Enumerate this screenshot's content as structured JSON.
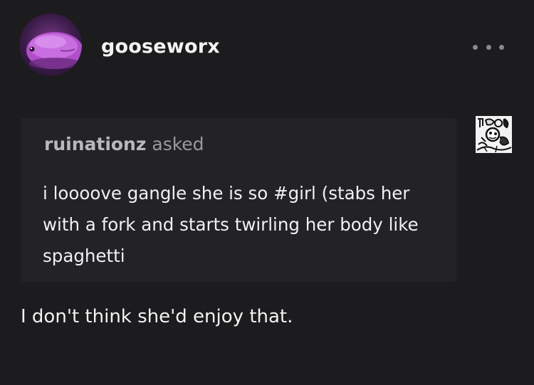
{
  "post": {
    "username": "gooseworx",
    "more_icon": "ellipsis-icon",
    "ask": {
      "asker": "ruinationz",
      "asked_label": "asked",
      "question": "i loooove gangle she is so #girl (stabs her with a fork and starts twirling her body like spaghetti"
    },
    "answer": "I don't think she'd enjoy that."
  }
}
